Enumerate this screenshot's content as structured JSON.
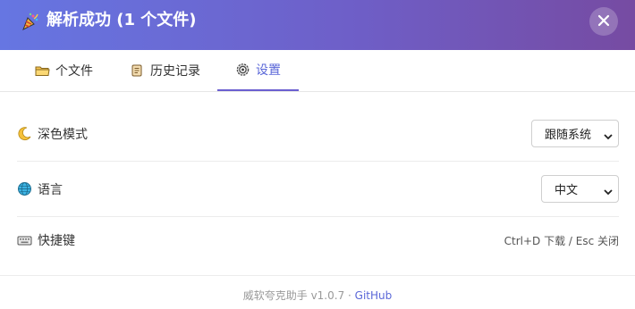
{
  "header": {
    "title": "解析成功 (1 个文件)",
    "icon": "party-popper-icon"
  },
  "tabs": [
    {
      "label": "个文件",
      "icon": "folder-icon",
      "active": false
    },
    {
      "label": "历史记录",
      "icon": "scroll-icon",
      "active": false
    },
    {
      "label": "设置",
      "icon": "gear-icon",
      "active": true
    }
  ],
  "settings": {
    "dark_mode": {
      "label": "深色模式",
      "icon": "crescent-moon-icon",
      "value": "跟随系统"
    },
    "language": {
      "label": "语言",
      "icon": "globe-icon",
      "value": "中文"
    },
    "shortcuts": {
      "label": "快捷键",
      "icon": "keyboard-icon",
      "value": "Ctrl+D 下载 / Esc 关闭"
    }
  },
  "footer": {
    "text": "威软夸克助手 v1.0.7 · ",
    "link": "GitHub"
  },
  "colors": {
    "header_gradient_start": "#6676e2",
    "header_gradient_end": "#764ba2",
    "accent": "#5a67d8"
  }
}
